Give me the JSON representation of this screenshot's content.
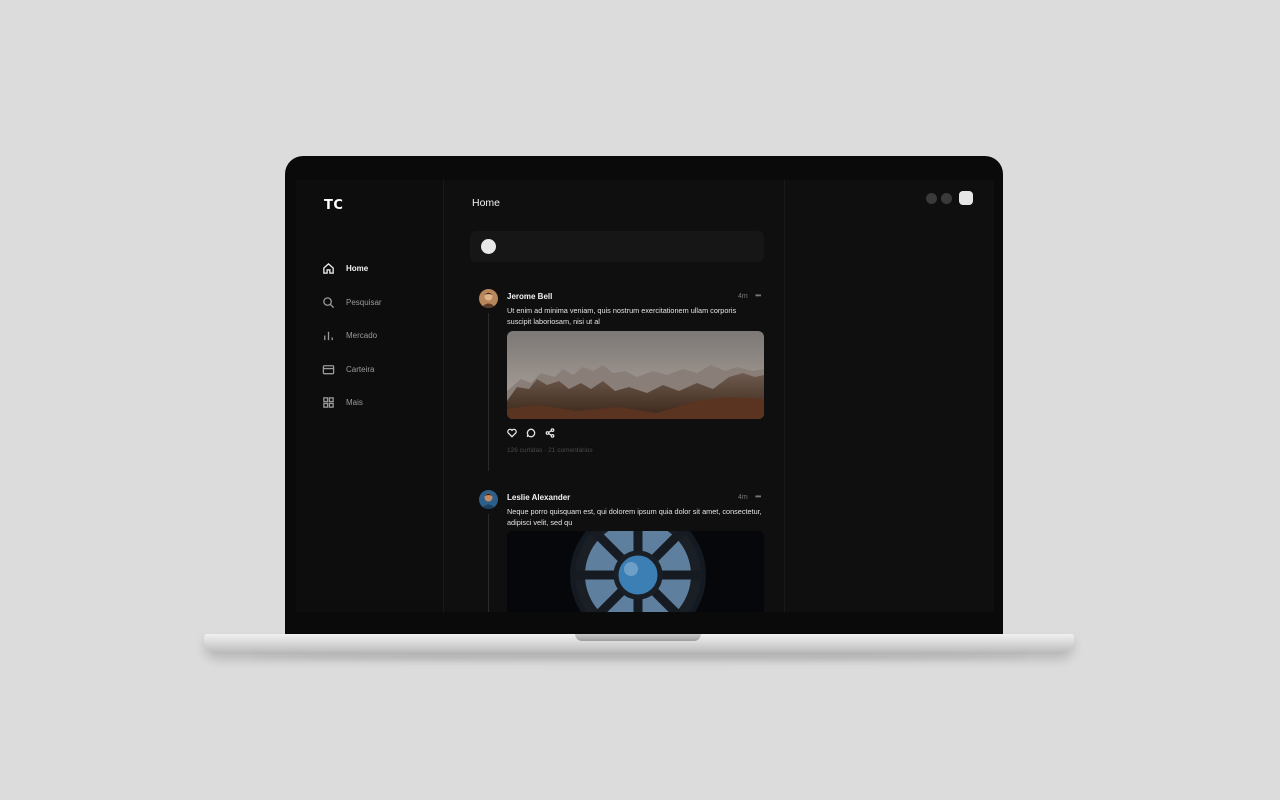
{
  "app": {
    "logo": "TC",
    "page_title": "Home"
  },
  "sidebar": {
    "items": [
      {
        "label": "Home",
        "icon": "home-icon",
        "active": true
      },
      {
        "label": "Pesquisar",
        "icon": "search-icon",
        "active": false
      },
      {
        "label": "Mercado",
        "icon": "bar-chart-icon",
        "active": false
      },
      {
        "label": "Carteira",
        "icon": "wallet-icon",
        "active": false
      },
      {
        "label": "Mais",
        "icon": "grid-icon",
        "active": false
      }
    ]
  },
  "feed": {
    "posts": [
      {
        "author": "Jerome Bell",
        "time": "4m",
        "text": "Ut enim ad minima veniam, quis nostrum exercitationem ullam corporis suscipit laboriosam, nisi ut al",
        "image": "desert-rock-landscape",
        "stats": "126 curtidas · 21 comentários"
      },
      {
        "author": "Leslie Alexander",
        "time": "4m",
        "text": "Neque porro quisquam est, qui dolorem ipsum quia dolor sit amet, consectetur, adipisci velit, sed qu",
        "image": "space-station-cupola-window"
      }
    ]
  },
  "colors": {
    "screen_bg": "#0f0f0f",
    "sidebar_bg": "#0d0d0d",
    "text_primary": "#f2f2f2",
    "text_muted": "#9a9a9a"
  }
}
